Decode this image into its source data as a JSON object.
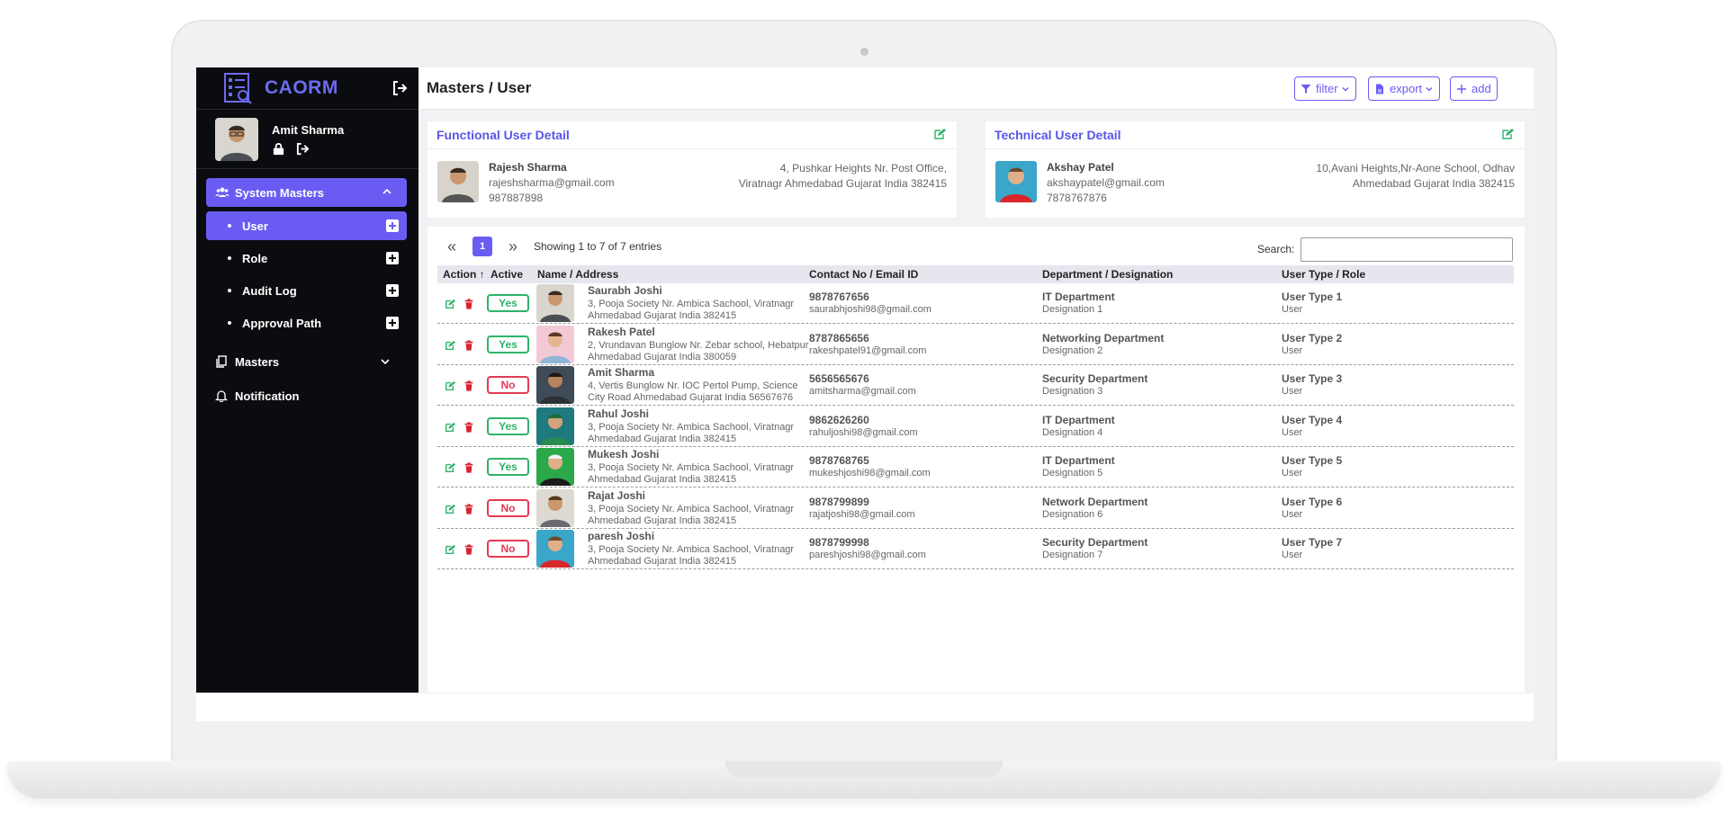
{
  "app": {
    "brand": "CAORM"
  },
  "profile": {
    "name": "Amit Sharma"
  },
  "sidebar": {
    "group_label": "System Masters",
    "items": [
      {
        "label": "User",
        "active": true
      },
      {
        "label": "Role",
        "active": false
      },
      {
        "label": "Audit Log",
        "active": false
      },
      {
        "label": "Approval Path",
        "active": false
      }
    ],
    "masters_label": "Masters",
    "notification_label": "Notification"
  },
  "header": {
    "title": "Masters / User",
    "filter_label": "filter",
    "export_label": "export",
    "add_label": "add"
  },
  "functional": {
    "title": "Functional User Detail",
    "name": "Rajesh Sharma",
    "email": "rajeshsharma@gmail.com",
    "phone": "987887898",
    "address_line1": "4, Pushkar Heights Nr. Post Office,",
    "address_line2": "Viratnagr Ahmedabad Gujarat India 382415"
  },
  "technical": {
    "title": "Technical User Detail",
    "name": "Akshay Patel",
    "email": "akshaypatel@gmail.com",
    "phone": "7878767876",
    "address_line1": "10,Avani Heights,Nr-Aone School, Odhav",
    "address_line2": "Ahmedabad Gujarat India 382415"
  },
  "table": {
    "page": "1",
    "info": "Showing 1 to 7 of 7 entries",
    "search_label": "Search:",
    "columns": [
      "Action ↑",
      "Active",
      "Name / Address",
      "Contact No / Email ID",
      "Department / Designation",
      "User Type / Role"
    ],
    "rows": [
      {
        "active": "Yes",
        "name": "Saurabh Joshi",
        "address": "3, Pooja Society Nr. Ambica Sachool, Viratnagr Ahmedabad Gujarat India 382415",
        "phone": "9878767656",
        "email": "saurabhjoshi98@gmail.com",
        "dept": "IT Department",
        "desig": "Designation 1",
        "type": "User Type 1",
        "role": "User"
      },
      {
        "active": "Yes",
        "name": "Rakesh Patel",
        "address": "2, Vrundavan Bunglow Nr. Zebar school, Hebatpur Ahmedabad Gujarat India 380059",
        "phone": "8787865656",
        "email": "rakeshpatel91@gmail.com",
        "dept": "Networking Department",
        "desig": "Designation 2",
        "type": "User Type 2",
        "role": "User"
      },
      {
        "active": "No",
        "name": "Amit Sharma",
        "address": "4, Vertis Bunglow Nr. IOC Pertol Pump, Science City Road Ahmedabad Gujarat India 56567676",
        "phone": "5656565676",
        "email": "amitsharma@gmail.com",
        "dept": "Security Department",
        "desig": "Designation 3",
        "type": "User Type 3",
        "role": "User"
      },
      {
        "active": "Yes",
        "name": "Rahul Joshi",
        "address": "3, Pooja Society Nr. Ambica Sachool, Viratnagr Ahmedabad Gujarat India 382415",
        "phone": "9862626260",
        "email": "rahuljoshi98@gmail.com",
        "dept": "IT Department",
        "desig": "Designation 4",
        "type": "User Type 4",
        "role": "User"
      },
      {
        "active": "Yes",
        "name": "Mukesh Joshi",
        "address": "3, Pooja Society Nr. Ambica Sachool, Viratnagr Ahmedabad Gujarat India 382415",
        "phone": "9878768765",
        "email": "mukeshjoshi98@gmail.com",
        "dept": "IT Department",
        "desig": "Designation 5",
        "type": "User Type 5",
        "role": "User"
      },
      {
        "active": "No",
        "name": "Rajat Joshi",
        "address": "3, Pooja Society Nr. Ambica Sachool, Viratnagr Ahmedabad Gujarat India 382415",
        "phone": "9878799899",
        "email": "rajatjoshi98@gmail.com",
        "dept": "Network Department",
        "desig": "Designation 6",
        "type": "User Type 6",
        "role": "User"
      },
      {
        "active": "No",
        "name": "paresh Joshi",
        "address": "3, Pooja Society Nr. Ambica Sachool, Viratnagr Ahmedabad Gujarat India 382415",
        "phone": "9878799998",
        "email": "pareshjoshi98@gmail.com",
        "dept": "Security Department",
        "desig": "Designation 7",
        "type": "User Type 7",
        "role": "User"
      }
    ]
  },
  "colors": {
    "accent": "#6a5cf3",
    "sidebar_bg": "#0b0c10",
    "yes": "#2fb36b",
    "no": "#e33a55",
    "edit": "#2fb36b",
    "delete": "#d9232e"
  },
  "icons": [
    "logo-icon",
    "logout-icon",
    "lock-icon",
    "users-icon",
    "chevron-up-icon",
    "chevron-down-icon",
    "plus-square-icon",
    "copy-icon",
    "bell-icon",
    "filter-icon",
    "file-icon",
    "plus-icon",
    "edit-icon",
    "trash-icon",
    "double-left-icon",
    "double-right-icon"
  ]
}
